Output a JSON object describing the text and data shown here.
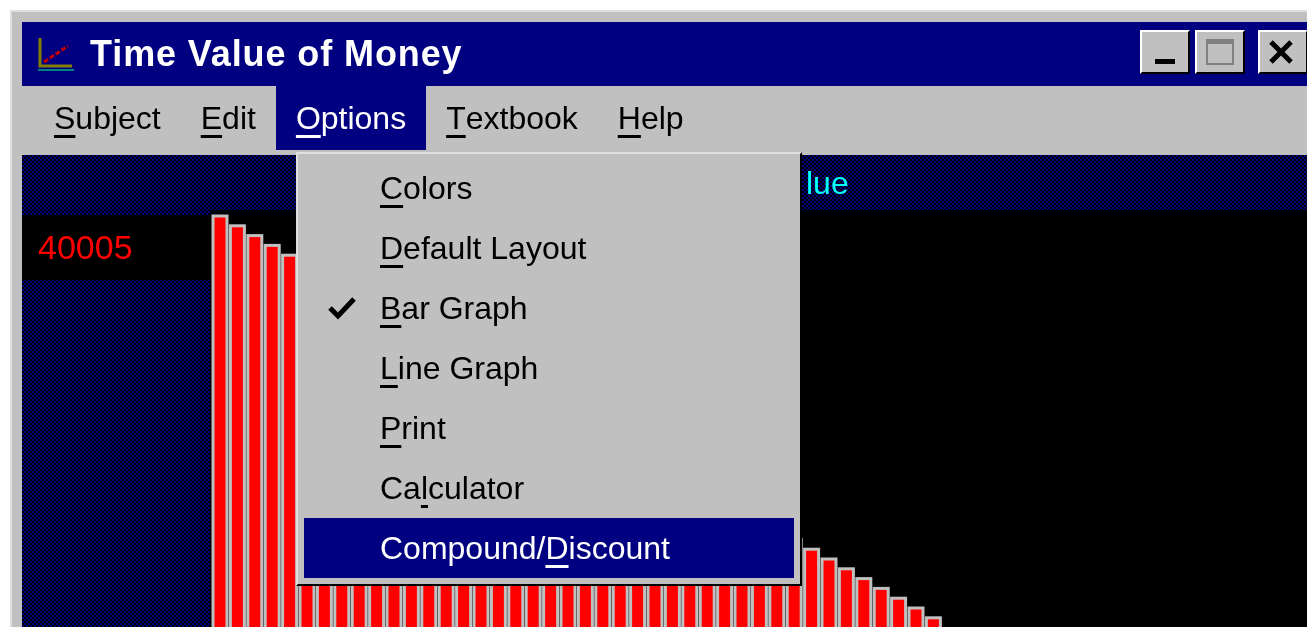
{
  "window": {
    "title": "Time Value of Money"
  },
  "menu_bar": [
    {
      "label": [
        {
          "text": "S",
          "underline": true
        },
        {
          "text": "ubject",
          "underline": false
        }
      ],
      "selected": false
    },
    {
      "label": [
        {
          "text": "E",
          "underline": true
        },
        {
          "text": "dit",
          "underline": false
        }
      ],
      "selected": false
    },
    {
      "label": [
        {
          "text": "O",
          "underline": true
        },
        {
          "text": "ptions",
          "underline": false
        }
      ],
      "selected": true
    },
    {
      "label": [
        {
          "text": "T",
          "underline": true
        },
        {
          "text": "extbook",
          "underline": false
        }
      ],
      "selected": false
    },
    {
      "label": [
        {
          "text": "H",
          "underline": true
        },
        {
          "text": "elp",
          "underline": false
        }
      ],
      "selected": false
    }
  ],
  "options_menu": [
    {
      "label": [
        {
          "text": "C",
          "underline": true
        },
        {
          "text": "olors",
          "underline": false
        }
      ],
      "checked": false,
      "selected": false
    },
    {
      "label": [
        {
          "text": "D",
          "underline": true
        },
        {
          "text": "efault Layout",
          "underline": false
        }
      ],
      "checked": false,
      "selected": false
    },
    {
      "label": [
        {
          "text": "B",
          "underline": true
        },
        {
          "text": "ar Graph",
          "underline": false
        }
      ],
      "checked": true,
      "selected": false
    },
    {
      "label": [
        {
          "text": "L",
          "underline": true
        },
        {
          "text": "ine Graph",
          "underline": false
        }
      ],
      "checked": false,
      "selected": false
    },
    {
      "label": [
        {
          "text": "P",
          "underline": true
        },
        {
          "text": "rint",
          "underline": false
        }
      ],
      "checked": false,
      "selected": false
    },
    {
      "label": [
        {
          "text": "Ca",
          "underline": false
        },
        {
          "text": "l",
          "underline": true
        },
        {
          "text": "culator",
          "underline": false
        }
      ],
      "checked": false,
      "selected": false
    },
    {
      "label": [
        {
          "text": "Compound/",
          "underline": false
        },
        {
          "text": "D",
          "underline": true
        },
        {
          "text": "iscount",
          "underline": false
        }
      ],
      "checked": false,
      "selected": true
    }
  ],
  "chart": {
    "title": "lue",
    "max_label": "40005"
  }
}
